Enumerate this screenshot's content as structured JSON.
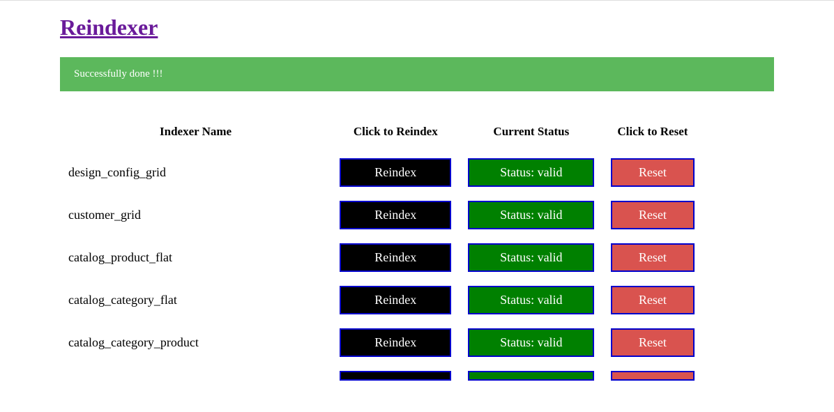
{
  "title": "Reindexer",
  "alert": "Successfully done !!!",
  "headers": {
    "name": "Indexer Name",
    "reindex": "Click to Reindex",
    "status": "Current Status",
    "reset": "Click to Reset"
  },
  "labels": {
    "reindex": "Reindex",
    "reset": "Reset",
    "status_prefix": "Status: "
  },
  "rows": [
    {
      "name": "design_config_grid",
      "status": "valid"
    },
    {
      "name": "customer_grid",
      "status": "valid"
    },
    {
      "name": "catalog_product_flat",
      "status": "valid"
    },
    {
      "name": "catalog_category_flat",
      "status": "valid"
    },
    {
      "name": "catalog_category_product",
      "status": "valid"
    }
  ]
}
